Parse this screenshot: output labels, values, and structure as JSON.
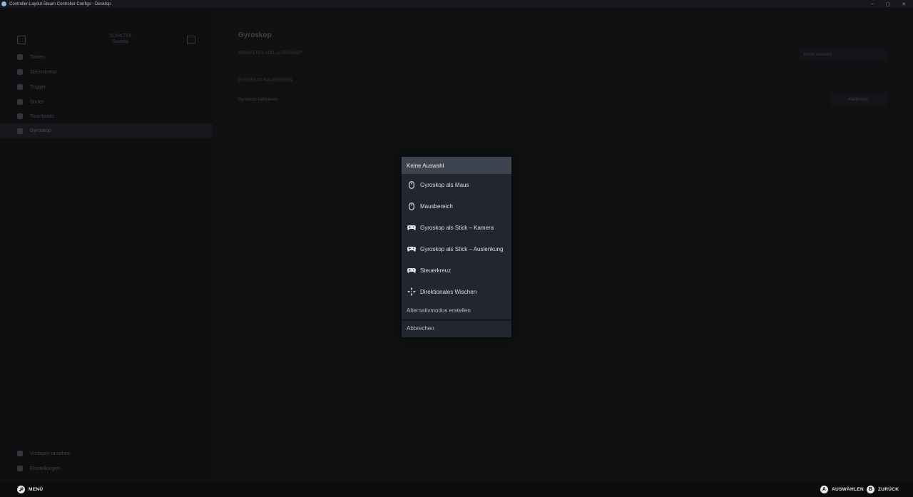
{
  "window": {
    "title": "Controller-Layout Steam Controller Configs - Desktop",
    "controls": [
      "–",
      "▢",
      "✕"
    ]
  },
  "sidebar": {
    "header_line1": "SCHALTER",
    "header_line2": "Desktop",
    "items": [
      {
        "label": "Tasten",
        "icon": "buttons-icon"
      },
      {
        "label": "Steuerkreuz",
        "icon": "dpad-icon"
      },
      {
        "label": "Trigger",
        "icon": "trigger-icon"
      },
      {
        "label": "Sticks",
        "icon": "stick-icon"
      },
      {
        "label": "Touchpads",
        "icon": "touchpad-icon"
      },
      {
        "label": "Gyroskop",
        "icon": "gyro-icon"
      }
    ],
    "bottom_items": [
      {
        "label": "Vorlagen ansehen",
        "icon": "templates-icon"
      },
      {
        "label": "Einstellungen",
        "icon": "settings-icon"
      }
    ]
  },
  "main": {
    "title": "Gyroskop",
    "subtitle": "VERHALTEN VON „GYROSKOP“",
    "select_value": "Keine Auswahl",
    "section": "GYROSKOP KALIBRIEREN",
    "row_label": "Gyroskop kalibrieren",
    "row_button": "Kalibrieren"
  },
  "menu": {
    "header": "Keine Auswahl",
    "items": [
      {
        "label": "Gyroskop als Maus",
        "icon": "mouse-icon"
      },
      {
        "label": "Mausbereich",
        "icon": "mouse-icon"
      },
      {
        "label": "Gyroskop als Stick – Kamera",
        "icon": "gamepad-icon"
      },
      {
        "label": "Gyroskop als Stick – Auslenkung",
        "icon": "gamepad-icon"
      },
      {
        "label": "Steuerkreuz",
        "icon": "gamepad-icon"
      },
      {
        "label": "Direktionales Wischen",
        "icon": "swipe-icon"
      }
    ],
    "alt_mode": "Alternativmodus erstellen",
    "cancel": "Abbrechen"
  },
  "footer": {
    "menu_label": "MENÜ",
    "select_glyph": "A",
    "select_label": "AUSWÄHLEN",
    "back_glyph": "B",
    "back_label": "ZURÜCK"
  }
}
